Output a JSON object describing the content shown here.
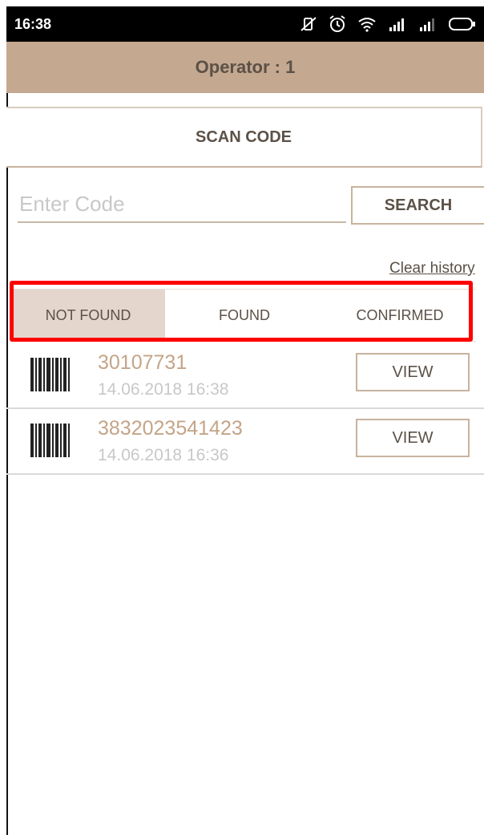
{
  "status_bar": {
    "time": "16:38",
    "icons": [
      "vibrate-off-icon",
      "alarm-icon",
      "wifi-icon",
      "signal-icon",
      "signal-icon",
      "battery-icon"
    ]
  },
  "header": {
    "title": "Operator : 1"
  },
  "scan": {
    "label": "SCAN CODE"
  },
  "search": {
    "placeholder": "Enter Code",
    "value": "",
    "button_label": "SEARCH"
  },
  "history": {
    "clear_label": "Clear history"
  },
  "tabs": [
    {
      "label": "NOT FOUND",
      "active": true
    },
    {
      "label": "FOUND",
      "active": false
    },
    {
      "label": "CONFIRMED",
      "active": false
    }
  ],
  "items": [
    {
      "code": "30107731",
      "datetime": "14.06.2018 16:38",
      "button_label": "VIEW"
    },
    {
      "code": "3832023541423",
      "datetime": "14.06.2018 16:36",
      "button_label": "VIEW"
    }
  ],
  "colors": {
    "header_bg": "#c4a890",
    "active_tab_bg": "#e4d6cc",
    "accent_text": "#c4a488",
    "highlight": "#ff0000"
  }
}
